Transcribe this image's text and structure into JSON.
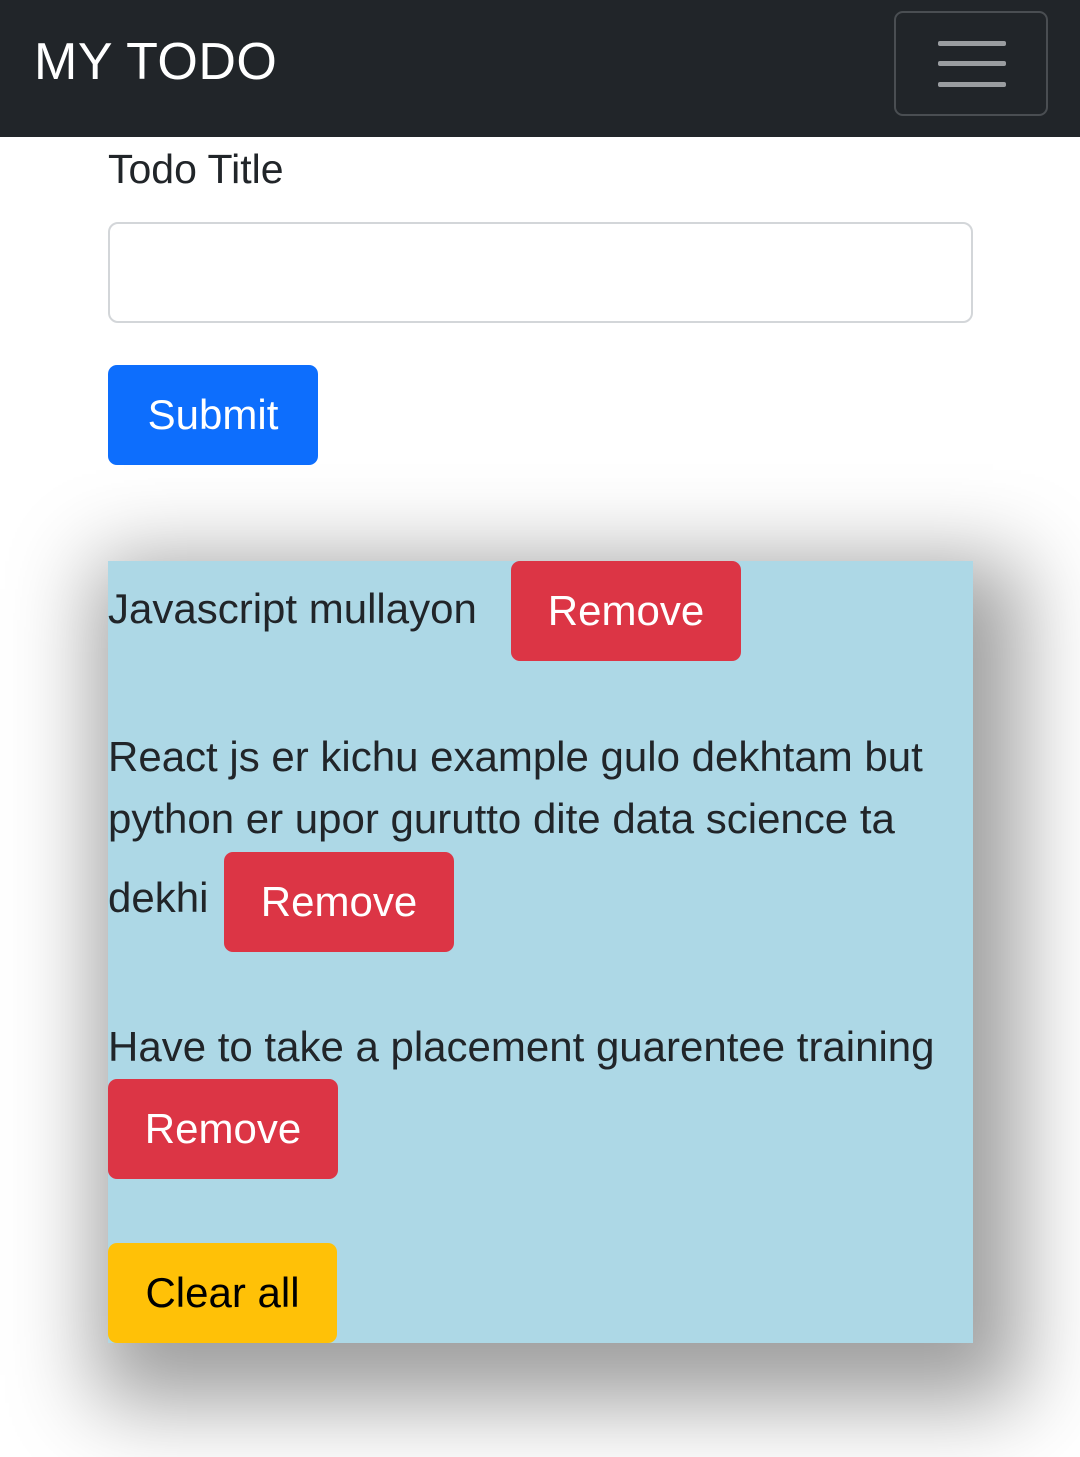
{
  "navbar": {
    "brand": "MY TODO",
    "toggler_icon": "hamburger-menu-icon"
  },
  "form": {
    "title_label": "Todo Title",
    "title_value": "",
    "submit_label": "Submit"
  },
  "todos": {
    "items": [
      {
        "text": "Javascript mullayon",
        "remove_label": "Remove"
      },
      {
        "text": "React js er kichu example gulo dekhtam but python er upor gurutto dite data science ta dekhi",
        "lines": [
          "React js er kichu example gulo dekhtam but",
          "python er upor gurutto dite data science ta",
          "dekhi"
        ],
        "remove_label": "Remove"
      },
      {
        "text": "Have to take a placement guarentee training",
        "remove_label": "Remove"
      }
    ],
    "clear_label": "Clear all"
  },
  "colors": {
    "navbar_bg": "#212529",
    "primary": "#0d6efd",
    "danger": "#dc3545",
    "warning": "#ffc107",
    "panel_bg": "#add8e6"
  }
}
